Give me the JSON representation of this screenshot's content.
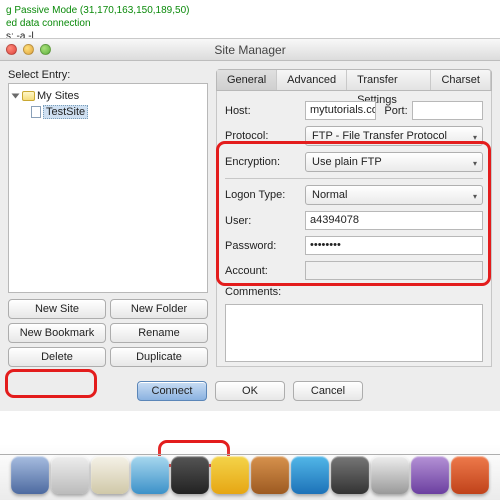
{
  "terminal": {
    "line1": "g Passive Mode (31,170,163,150,189,50)",
    "line2": "ed data connection",
    "line3": "s: -a -l"
  },
  "window": {
    "title": "Site Manager"
  },
  "sidebar": {
    "label": "Select Entry:",
    "root": "My Sites",
    "item": "TestSite"
  },
  "buttons": {
    "newSite": "New Site",
    "newFolder": "New Folder",
    "newBookmark": "New Bookmark",
    "rename": "Rename",
    "delete": "Delete",
    "duplicate": "Duplicate",
    "connect": "Connect",
    "ok": "OK",
    "cancel": "Cancel"
  },
  "tabs": {
    "general": "General",
    "advanced": "Advanced",
    "transfer": "Transfer Settings",
    "charset": "Charset"
  },
  "form": {
    "hostLabel": "Host:",
    "hostValue": "mytutorials.comuv.com",
    "portLabel": "Port:",
    "portValue": "",
    "protocolLabel": "Protocol:",
    "protocolValue": "FTP - File Transfer Protocol",
    "encryptionLabel": "Encryption:",
    "encryptionValue": "Use plain FTP",
    "logonLabel": "Logon Type:",
    "logonValue": "Normal",
    "userLabel": "User:",
    "userValue": "a4394078",
    "passwordLabel": "Password:",
    "passwordValue": "••••••••",
    "accountLabel": "Account:",
    "accountValue": "",
    "commentsLabel": "Comments:"
  },
  "colors": {
    "highlight": "#e31c1c"
  }
}
